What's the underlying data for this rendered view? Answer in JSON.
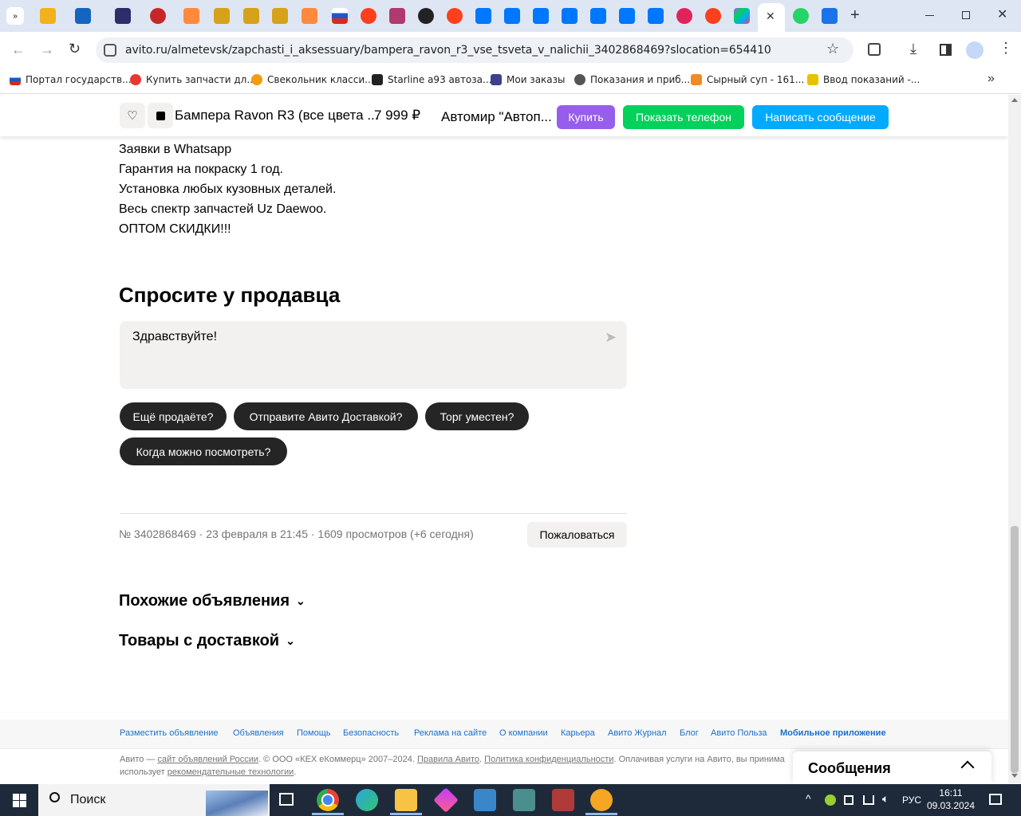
{
  "browser": {
    "url": "avito.ru/almetevsk/zapchasti_i_aksessuary/bampera_ravon_r3_vse_tsveta_v_nalichii_3402868469?slocation=654410",
    "tab_close": "✕",
    "new_tab": "+",
    "bookmarks": [
      "Портал государств...",
      "Купить запчасти дл...",
      "Свекольник класси...",
      "Starline a93 автоза...",
      "Мои заказы",
      "Показания и приб...",
      "Сырный суп - 161...",
      "Ввод показаний -..."
    ],
    "bookmarks_more": "»"
  },
  "sticky_header": {
    "title": "Бампера Ravon R3 (все цвета ...",
    "price": "7 999 ₽",
    "seller": "Автомир \"Автоп...",
    "buy_label": "Купить",
    "phone_label": "Показать телефон",
    "message_label": "Написать сообщение",
    "colors": {
      "buy": "#965eeb",
      "phone": "#02d15c",
      "message": "#00aaff"
    }
  },
  "description": {
    "lines": [
      "Заявки в Whatsapp",
      "Гарантия на покраску 1 год.",
      "Установка любых кузовных деталей.",
      "Весь спектр запчастей Uz Daewoo.",
      "ОПТОМ СКИДКИ!!!"
    ]
  },
  "ask": {
    "title": "Спросите у продавца",
    "message_value": "Здравствуйте!",
    "quick_replies": [
      "Ещё продаёте?",
      "Отправите Авито Доставкой?",
      "Торг уместен?",
      "Когда можно посмотреть?"
    ]
  },
  "meta": {
    "text": "№ 3402868469 · 23 февраля в 21:45 · 1609 просмотров (+6 сегодня)",
    "complain_label": "Пожаловаться"
  },
  "sections": {
    "similar": "Похожие объявления",
    "delivery": "Товары с доставкой"
  },
  "footer": {
    "links": [
      "Разместить объявление",
      "Объявления",
      "Помощь",
      "Безопасность",
      "Реклама на сайте",
      "О компании",
      "Карьера",
      "Авито Журнал",
      "Блог",
      "Авито Польза",
      "Мобильное приложение"
    ],
    "legal_prefix": "Авито — ",
    "legal_link1": "сайт объявлений России",
    "legal_mid": ". © ООО «КЕХ еКоммерц» 2007–2024. ",
    "legal_link2": "Правила Авито",
    "legal_sep": ". ",
    "legal_link3": "Политика конфиденциальности",
    "legal_tail": ". Оплачивая услуги на Авито, вы принима",
    "legal_line2_prefix": "использует ",
    "legal_line2_link": "рекомендательные технологии",
    "legal_line2_suffix": "."
  },
  "messenger": {
    "label": "Сообщения"
  },
  "taskbar": {
    "search_placeholder": "Поиск",
    "lang": "РУС",
    "time": "16:11",
    "date": "09.03.2024"
  }
}
